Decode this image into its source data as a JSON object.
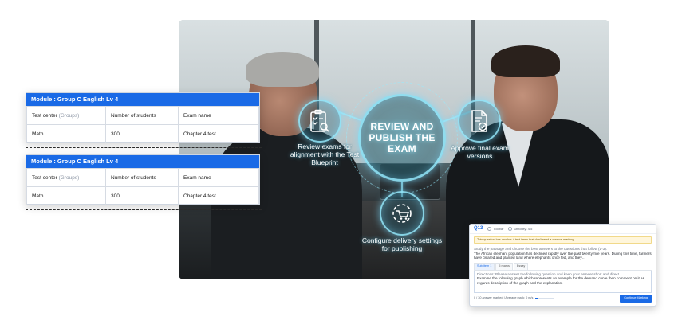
{
  "hero": {
    "center_title": "REVIEW AND PUBLISH THE EXAM",
    "steps": {
      "review": "Review exams for alignment with the Test Blueprint",
      "approve": "Approve final exam versions",
      "configure": "Configure delivery settings for publishing"
    },
    "icons": {
      "review": "clipboard-search-icon",
      "approve": "document-check-icon",
      "configure": "gear-cart-icon"
    },
    "accent_color": "#96ebff"
  },
  "modules": [
    {
      "title": "Module : Group C English Lv 4",
      "columns": {
        "test_center": "Test center",
        "groups": "(Groups)",
        "students": "Number of students",
        "exam": "Exam name"
      },
      "row": {
        "test_center": "Math",
        "students": "300",
        "exam": "Chapter 4 test"
      }
    },
    {
      "title": "Module : Group C English Lv 4",
      "columns": {
        "test_center": "Test center",
        "groups": "(Groups)",
        "students": "Number of students",
        "exam": "Exam name"
      },
      "row": {
        "test_center": "Math",
        "students": "300",
        "exam": "Chapter 4 test"
      }
    }
  ],
  "question": {
    "number": "Q13",
    "chip_1": "Toolbar",
    "chip_2": "Difficulty: 4/5",
    "warning": "This question has another 4 test items that don't need a manual marking.",
    "instruction": "Study the passage and choose the best answers to the questions that follow (1-3).",
    "passage": "The African elephant population has declined rapidly over the past twenty-five years. During this time, farmers have cleared and planted land where elephants once fed, and they…",
    "tabs": [
      "Sub-item 1",
      "5 marks",
      "Essay"
    ],
    "directions": "Directions: Please answer the following question and keep your answer short and direct.",
    "prompt": "Examine the following graph which represents an example for the demand curve then comment on it as regards description of the graph and the explanation.",
    "progress_text": "0 / 30 answer marked | Average mark: 0 m/s",
    "progress_fraction": 0.1,
    "button": "Continue Marking",
    "accent_color": "#1a6ae6"
  }
}
